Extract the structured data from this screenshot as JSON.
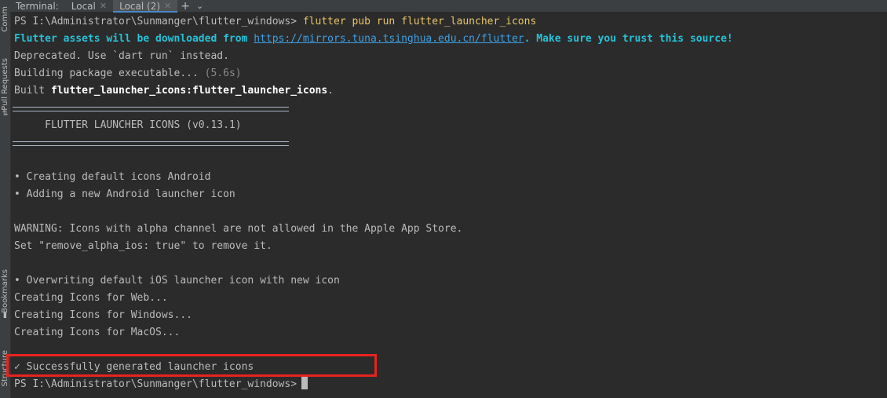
{
  "tabbar": {
    "title": "Terminal:",
    "tabs": [
      {
        "label": "Local",
        "active": false
      },
      {
        "label": "Local (2)",
        "active": true
      }
    ],
    "add_icon": "plus-icon",
    "dropdown_icon": "chevron-down-icon"
  },
  "sidebar": {
    "labels": [
      "Comm",
      "Pull Requests",
      "Bookmarks",
      "Structure"
    ]
  },
  "terminal": {
    "prompt": "PS I:\\Administrator\\Sunmanger\\flutter_windows> ",
    "command": "flutter pub run flutter_launcher_icons",
    "assets_prefix": "Flutter assets will be downloaded from ",
    "assets_link": "https://mirrors.tuna.tsinghua.edu.cn/flutter",
    "assets_suffix": ". Make sure you trust this source!",
    "deprecated": "Deprecated. Use `dart run` instead.",
    "building": "Building package executable... ",
    "building_time": "(5.6s)",
    "built_prefix": "Built ",
    "built_target": "flutter_launcher_icons:flutter_launcher_icons",
    "built_suffix": ".",
    "banner": "FLUTTER LAUNCHER ICONS (v0.13.1)",
    "creating_android": "• Creating default icons Android",
    "adding_android": "• Adding a new Android launcher icon",
    "warning": "WARNING: Icons with alpha channel are not allowed in the Apple App Store.",
    "set_alpha": "Set \"remove_alpha_ios: true\" to remove it.",
    "overwriting_ios": "• Overwriting default iOS launcher icon with new icon",
    "creating_web": "Creating Icons for Web...",
    "creating_windows": "Creating Icons for Windows...",
    "creating_macos": "Creating Icons for MacOS...",
    "success": "✓ Successfully generated launcher icons",
    "final_prompt": "PS I:\\Administrator\\Sunmanger\\flutter_windows>"
  },
  "colors": {
    "background": "#2b2b2b",
    "command": "#e8c46a",
    "info_cyan": "#25c2d8",
    "highlight_box": "#e8231f"
  }
}
